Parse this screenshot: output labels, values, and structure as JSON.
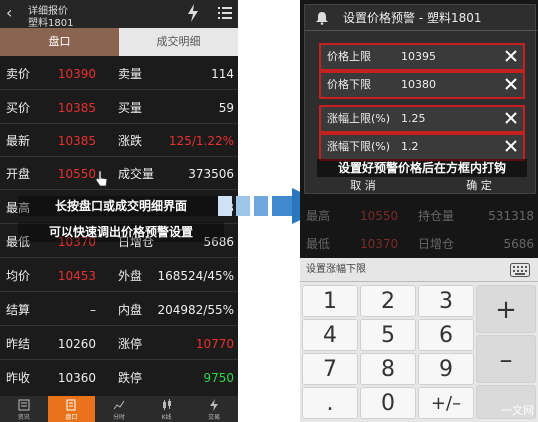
{
  "left": {
    "header": {
      "title": "详细报价",
      "subtitle": "塑料1801"
    },
    "tabs": [
      "盘口",
      "成交明细"
    ],
    "rows": [
      {
        "l1": "卖价",
        "v1": "10390",
        "l2": "卖量",
        "v2": "114"
      },
      {
        "l1": "买价",
        "v1": "10385",
        "l2": "买量",
        "v2": "59"
      },
      {
        "l1": "最新",
        "v1": "10385",
        "l2": "涨跌",
        "v2": "125/1.22%"
      },
      {
        "l1": "开盘",
        "v1": "10550",
        "l2": "成交量",
        "v2": "373506"
      },
      {
        "l1": "最高",
        "v1": "",
        "l2": "",
        "v2": "53"
      },
      {
        "l1": "最低",
        "v1": "10370",
        "l2": "日增仓",
        "v2": "5686"
      },
      {
        "l1": "均价",
        "v1": "10453",
        "l2": "外盘",
        "v2": "168524/45%"
      },
      {
        "l1": "结算",
        "v1": "–",
        "l2": "内盘",
        "v2": "204982/55%"
      },
      {
        "l1": "昨结",
        "v1": "10260",
        "l2": "涨停",
        "v2": "10770"
      },
      {
        "l1": "昨收",
        "v1": "10360",
        "l2": "跌停",
        "v2": "9750"
      }
    ],
    "overlay1": "长按盘口或成交明细界面",
    "overlay2": "可以快速调出价格预警设置",
    "bottom_nav": [
      "资讯",
      "盘口",
      "分时",
      "K线",
      "交易"
    ]
  },
  "right": {
    "dialog": {
      "title": "设置价格预警 - 塑料1801",
      "fields": [
        {
          "label": "价格上限",
          "value": "10395"
        },
        {
          "label": "价格下限",
          "value": "10380"
        },
        {
          "label": "涨幅上限(%)",
          "value": "1.25"
        },
        {
          "label": "涨幅下限(%)",
          "value": "1.2"
        }
      ],
      "hint": "设置好预警价格后在方框内打钩",
      "cancel": "取 消",
      "ok": "确 定"
    },
    "background_rows": [
      {
        "l1": "最高",
        "v1": "10550",
        "l2": "持仓量",
        "v2": "531318"
      },
      {
        "l1": "最低",
        "v1": "10370",
        "l2": "日增仓",
        "v2": "5686"
      }
    ],
    "keyboard": {
      "label": "设置涨幅下限",
      "keys": [
        "1",
        "2",
        "3",
        "4",
        "5",
        "6",
        "7",
        "8",
        "9",
        ".",
        "0",
        "+/–"
      ],
      "side_keys": [
        "+",
        "–"
      ]
    },
    "watermark": "一文网"
  },
  "colors": {
    "up": "#e8312f",
    "down": "#2fd54a",
    "accent": "#e8731a",
    "tab_active": "#8a6450",
    "alert_border": "#c62121"
  }
}
